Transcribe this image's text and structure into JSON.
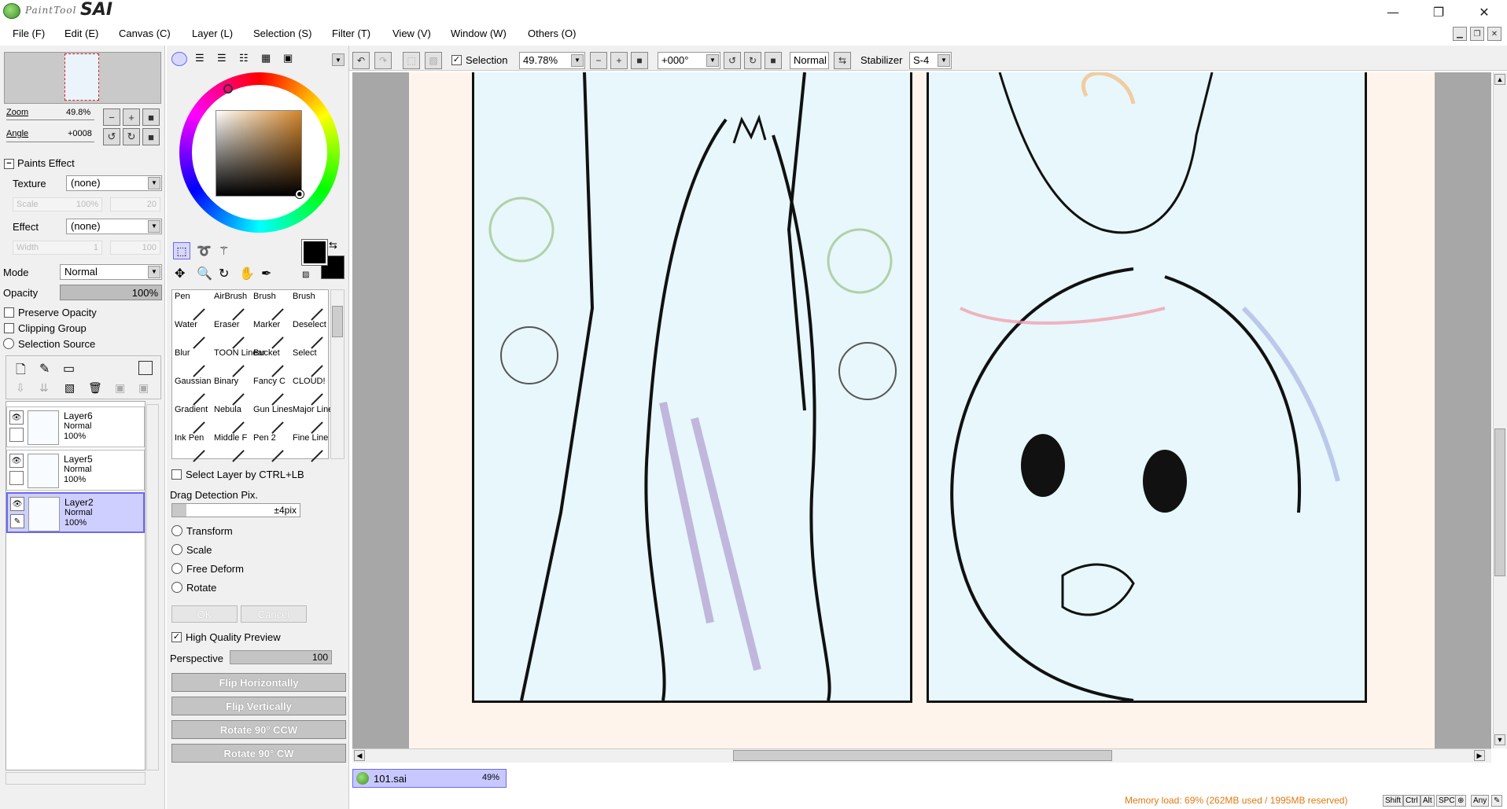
{
  "app": {
    "logo_small": "PaintTool",
    "logo_big": "SAI",
    "window_controls": {
      "minimize": "—",
      "restore": "❐",
      "close": "✕"
    }
  },
  "menu": [
    {
      "label": "File (F)"
    },
    {
      "label": "Edit (E)"
    },
    {
      "label": "Canvas (C)"
    },
    {
      "label": "Layer (L)"
    },
    {
      "label": "Selection (S)"
    },
    {
      "label": "Filter (T)"
    },
    {
      "label": "View (V)"
    },
    {
      "label": "Window (W)"
    },
    {
      "label": "Others (O)"
    }
  ],
  "navigator": {
    "zoom_label": "Zoom",
    "zoom_value": "49.8%",
    "angle_label": "Angle",
    "angle_value": "+0008"
  },
  "paints_effect": {
    "header": "Paints Effect",
    "texture_label": "Texture",
    "texture_value": "(none)",
    "scale_label": "Scale",
    "scale_value": "100%",
    "scale_num": "20",
    "effect_label": "Effect",
    "effect_value": "(none)",
    "width_label": "Width",
    "width_value": "1",
    "width_num": "100"
  },
  "layer_props": {
    "mode_label": "Mode",
    "mode_value": "Normal",
    "opacity_label": "Opacity",
    "opacity_value": "100%",
    "preserve_opacity": "Preserve Opacity",
    "clipping_group": "Clipping Group",
    "selection_source": "Selection Source"
  },
  "layers": [
    {
      "name": "Layer6",
      "mode": "Normal",
      "opacity": "100%",
      "selected": false
    },
    {
      "name": "Layer5",
      "mode": "Normal",
      "opacity": "100%",
      "selected": false
    },
    {
      "name": "Layer2",
      "mode": "Normal",
      "opacity": "100%",
      "selected": true
    }
  ],
  "brushes": [
    [
      "Pen",
      "AirBrush",
      "Brush",
      "Brush"
    ],
    [
      "Water",
      "Eraser",
      "Marker",
      "Deselect"
    ],
    [
      "Blur",
      "TOON Linear",
      "Bucket",
      "Select"
    ],
    [
      "Gaussian",
      "Binary",
      "Fancy C",
      "CLOUD!"
    ],
    [
      "Gradient",
      "Nebula",
      "Gun Lines",
      "Major Line"
    ],
    [
      "Ink Pen",
      "Middle F",
      "Pen 2",
      "Fine Line"
    ]
  ],
  "transform": {
    "select_by_ctrl": "Select Layer by CTRL+LB",
    "drag_detection_label": "Drag Detection Pix.",
    "drag_detection_value": "±4pix",
    "transform": "Transform",
    "scale": "Scale",
    "free_deform": "Free Deform",
    "rotate": "Rotate",
    "ok": "OK",
    "cancel": "Cancel",
    "high_quality_preview": "High Quality Preview",
    "perspective_label": "Perspective",
    "perspective_value": "100",
    "flip_h": "Flip Horizontally",
    "flip_v": "Flip Vertically",
    "rotate_ccw": "Rotate 90° CCW",
    "rotate_cw": "Rotate 90° CW"
  },
  "toolbar": {
    "selection_label": "Selection",
    "zoom_value": "49.78%",
    "angle_value": "+000°",
    "blend_mode": "Normal",
    "stabilizer_label": "Stabilizer",
    "stabilizer_value": "S-4"
  },
  "file_tab": {
    "name": "101.sai",
    "zoom": "49%"
  },
  "status": {
    "memory": "Memory load: 69% (262MB used / 1995MB reserved)",
    "keys": [
      "Shift",
      "Ctrl",
      "Alt",
      "SPC",
      "⊕",
      "Any",
      "✎"
    ]
  },
  "colors": {
    "primary": "#000000",
    "secondary": "#000000",
    "accent_selected": "#c8c8ff",
    "status_text": "#e07a10"
  }
}
